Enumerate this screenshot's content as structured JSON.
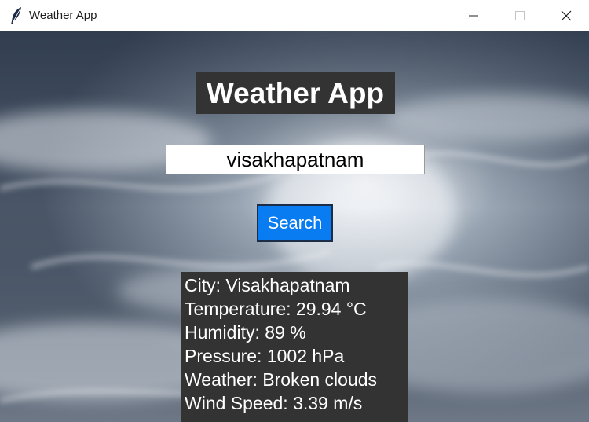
{
  "window": {
    "title": "Weather App",
    "app_icon": "feather-icon",
    "controls": {
      "minimize_icon": "minimize-icon",
      "maximize_icon": "maximize-icon",
      "close_icon": "close-icon"
    }
  },
  "main": {
    "heading": "Weather App",
    "search_input_value": "visakhapatnam",
    "search_button_label": "Search",
    "results": {
      "city": "City: Visakhapatnam",
      "temperature": "Temperature: 29.94 °C",
      "humidity": "Humidity: 89 %",
      "pressure": "Pressure: 1002 hPa",
      "weather": "Weather: Broken clouds",
      "wind_speed": "Wind Speed: 3.39 m/s"
    }
  },
  "colors": {
    "heading_bg": "#333333",
    "button_bg": "#0a7cf2",
    "panel_bg": "#333333",
    "text_light": "#ffffff"
  }
}
